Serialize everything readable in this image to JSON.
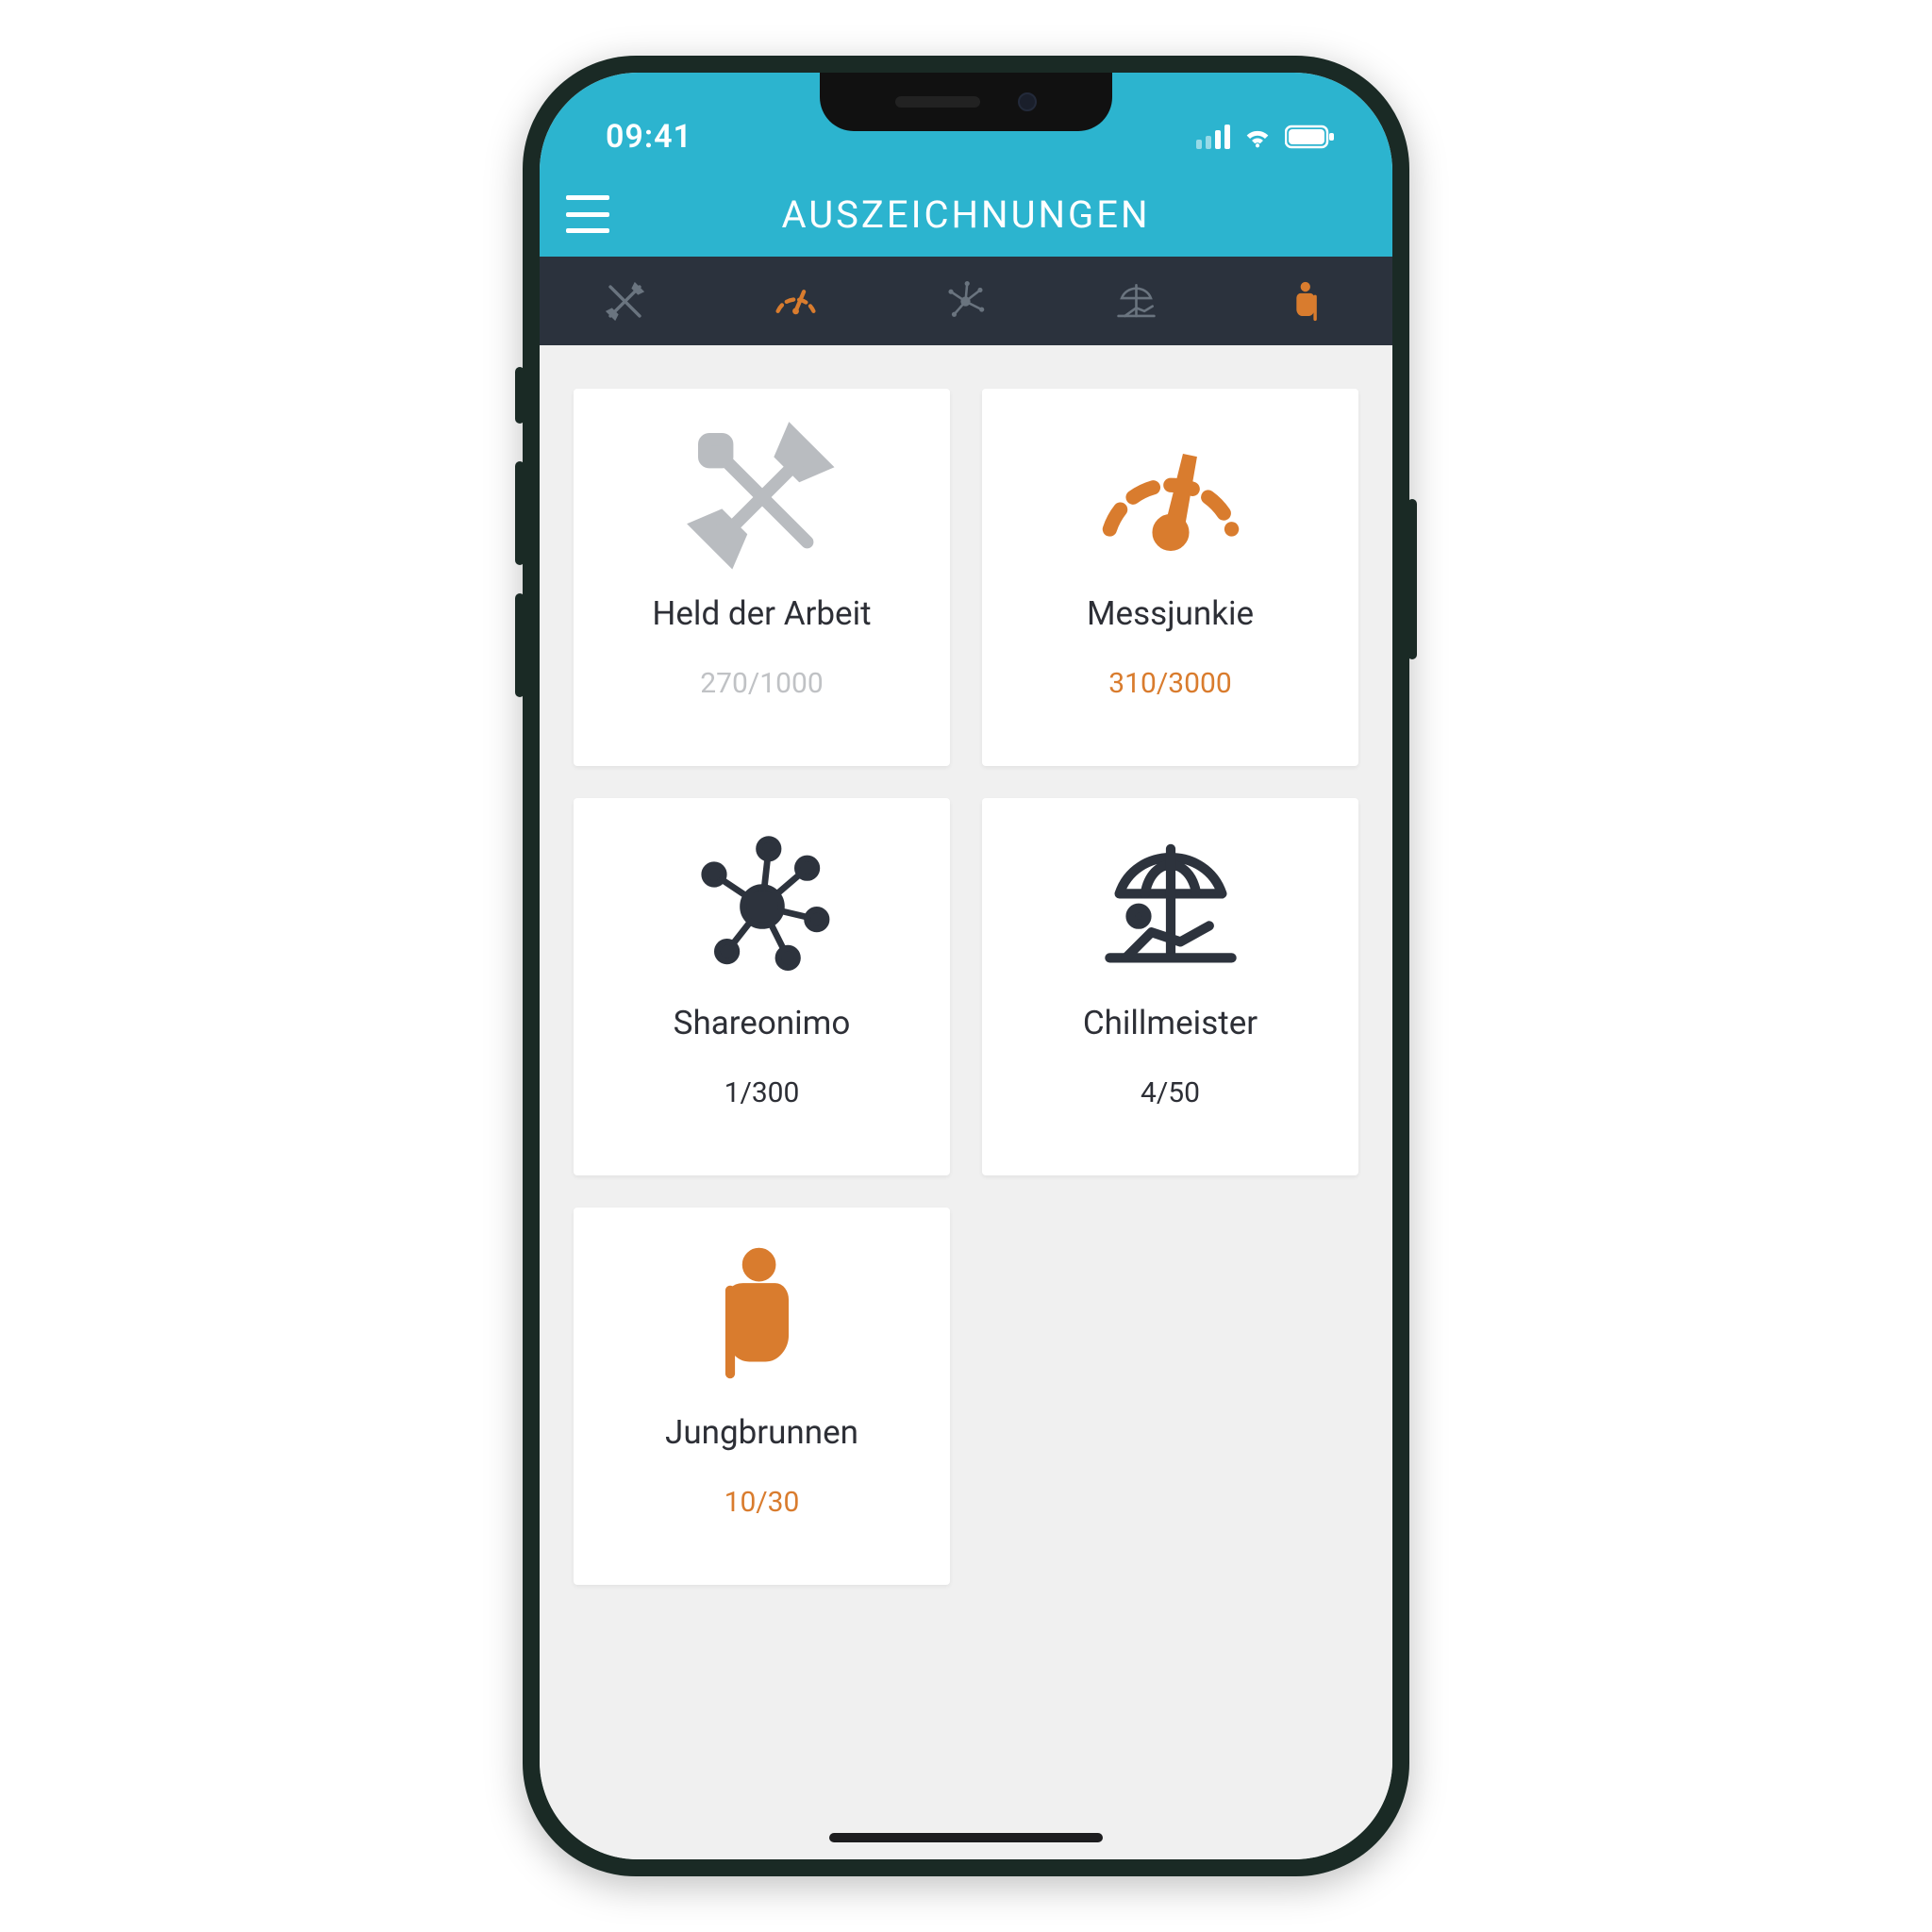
{
  "status": {
    "time": "09:41"
  },
  "header": {
    "title": "AUSZEICHNUNGEN"
  },
  "tabs": [
    {
      "icon": "crossed-tools-icon",
      "active": false
    },
    {
      "icon": "gauge-icon",
      "active": true
    },
    {
      "icon": "network-icon",
      "active": false
    },
    {
      "icon": "umbrella-beach-icon",
      "active": false
    },
    {
      "icon": "person-cane-icon",
      "active": true
    }
  ],
  "cards": [
    {
      "icon": "crossed-tools-icon",
      "color": "grey",
      "title": "Held der Arbeit",
      "progress": "270/1000",
      "progress_style": "muted"
    },
    {
      "icon": "gauge-icon",
      "color": "orange",
      "title": "Messjunkie",
      "progress": "310/3000",
      "progress_style": "highlight"
    },
    {
      "icon": "network-icon",
      "color": "dark",
      "title": "Shareonimo",
      "progress": "1/300",
      "progress_style": "normal"
    },
    {
      "icon": "umbrella-beach-icon",
      "color": "dark",
      "title": "Chillmeister",
      "progress": "4/50",
      "progress_style": "normal"
    },
    {
      "icon": "person-cane-icon",
      "color": "orange",
      "title": "Jungbrunnen",
      "progress": "10/30",
      "progress_style": "highlight"
    }
  ],
  "colors": {
    "accent": "#2cb4cf",
    "highlight": "#d97c2e",
    "tabbar": "#2b323d"
  }
}
